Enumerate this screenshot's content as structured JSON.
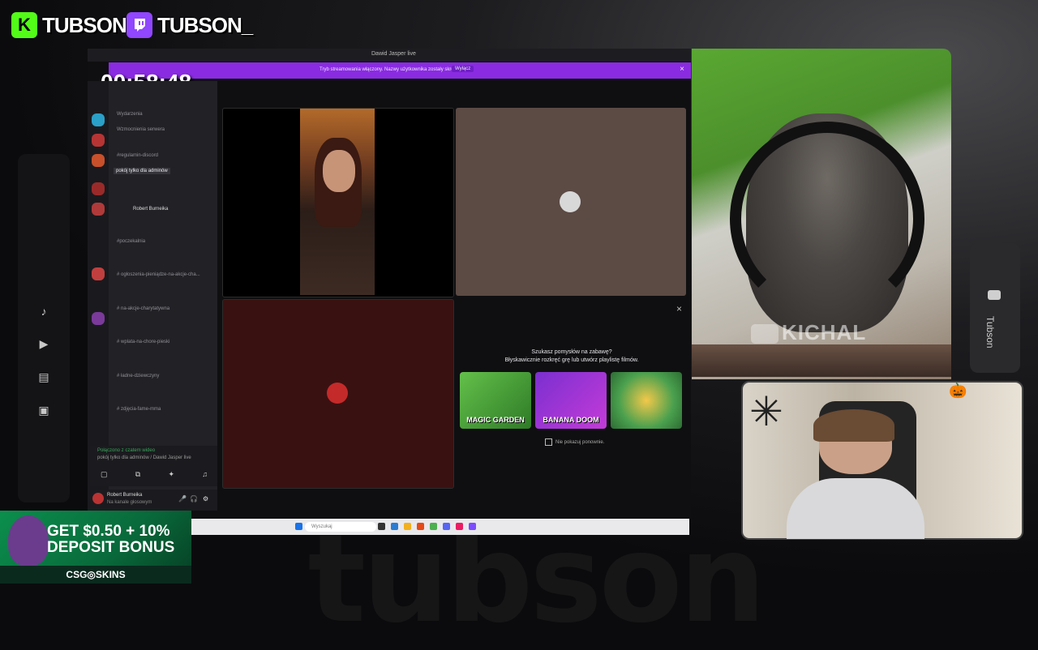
{
  "overlay": {
    "kick_handle": "TUBSON",
    "twitch_handle": "TUBSON_",
    "timer": "00:58:48",
    "watermark": "tubson",
    "side_tab_label": "Tubson",
    "kick_logo": "K"
  },
  "window": {
    "title": "Dawid Jasper live",
    "banner_message": "Tryb streamowania włączony. Nazwy użytkownika zostały skrócone.",
    "banner_button": "Wyłącz"
  },
  "channels": [
    {
      "label": "Wydarzenia"
    },
    {
      "label": "Wzmocnienia serwera"
    },
    {
      "label": "#regulamin-discord"
    },
    {
      "label": "pokój tylko dla adminów",
      "highlight": true
    },
    {
      "label": "Robert Burneika"
    },
    {
      "label": "#poczekalnia"
    },
    {
      "label": "# ogłoszenia-pieniądze-na-akcje-cha..."
    },
    {
      "label": "# na-akcje-charytatywna"
    },
    {
      "label": "# wplata-na-chore-pieski"
    },
    {
      "label": "# ładne-dziewczyny"
    },
    {
      "label": "# zdjęcia-fame-mma"
    }
  ],
  "voice": {
    "status": "Połączono z czatem wideo",
    "channel": "pokój tylko dla adminów / Dawid Jasper live"
  },
  "user": {
    "name": "Robert Burneika",
    "status": "Na kanale głosowym"
  },
  "promo": {
    "title": "Szukasz pomysłów na zabawę?",
    "subtitle": "Błyskawicznie rozkręć grę lub utwórz playlistę filmów.",
    "games": [
      "MAGIC GARDEN",
      "BANANA DOOM",
      ""
    ],
    "dont_show": "Nie pokazuj ponownie."
  },
  "taskbar": {
    "search": "Wyszukaj"
  },
  "webcam": {
    "label": "KICHAL"
  },
  "ad": {
    "headline_1": "GET $0.50 + 10%",
    "headline_2": "DEPOSIT BONUS",
    "brand": "CSG◎SKINS"
  },
  "colors": {
    "kick_green": "#53fc18",
    "twitch_purple": "#9146ff",
    "discord_banner": "#8a2be2"
  }
}
